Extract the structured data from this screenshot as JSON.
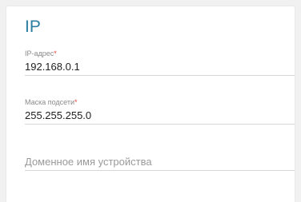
{
  "section": {
    "title": "IP"
  },
  "fields": {
    "ip": {
      "label": "IP-адрес",
      "required_mark": "*",
      "value": "192.168.0.1"
    },
    "mask": {
      "label": "Маска подсети",
      "required_mark": "*",
      "value": "255.255.255.0"
    },
    "domain": {
      "placeholder": "Доменное имя устройства",
      "value": ""
    }
  },
  "colors": {
    "accent": "#2b7ea1",
    "required": "#e8403a",
    "background": "#f1f1f1"
  }
}
